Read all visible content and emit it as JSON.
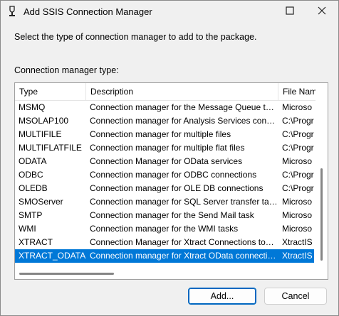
{
  "window": {
    "title": "Add SSIS Connection Manager"
  },
  "instruction": "Select the type of connection manager to add to the package.",
  "list_label": "Connection manager type:",
  "columns": [
    "Type",
    "Description",
    "File Nam"
  ],
  "rows": [
    {
      "type": "MSMQ",
      "description": "Connection manager for the Message Queue t…",
      "file": "Microso"
    },
    {
      "type": "MSOLAP100",
      "description": "Connection manager for Analysis Services con…",
      "file": "C:\\Progr"
    },
    {
      "type": "MULTIFILE",
      "description": "Connection manager for multiple files",
      "file": "C:\\Progr"
    },
    {
      "type": "MULTIFLATFILE",
      "description": "Connection manager for multiple flat files",
      "file": "C:\\Progr"
    },
    {
      "type": "ODATA",
      "description": "Connection Manager for OData services",
      "file": "Microso"
    },
    {
      "type": "ODBC",
      "description": "Connection manager for ODBC connections",
      "file": "C:\\Progr"
    },
    {
      "type": "OLEDB",
      "description": "Connection manager for OLE DB connections",
      "file": "C:\\Progr"
    },
    {
      "type": "SMOServer",
      "description": "Connection manager for SQL Server transfer ta…",
      "file": "Microso"
    },
    {
      "type": "SMTP",
      "description": "Connection manager for the Send Mail task",
      "file": "Microso"
    },
    {
      "type": "WMI",
      "description": "Connection manager for the WMI tasks",
      "file": "Microso"
    },
    {
      "type": "XTRACT",
      "description": "Connection Manager for Xtract Connections to…",
      "file": "XtractIS"
    },
    {
      "type": "XTRACT_ODATA",
      "description": "Connection manager for Xtract OData connecti…",
      "file": "XtractIS"
    }
  ],
  "selected_row": "XTRACT_ODATA",
  "buttons": {
    "add": "Add...",
    "cancel": "Cancel"
  },
  "colors": {
    "selection": "#0078d7",
    "primary_border": "#0067c0"
  }
}
